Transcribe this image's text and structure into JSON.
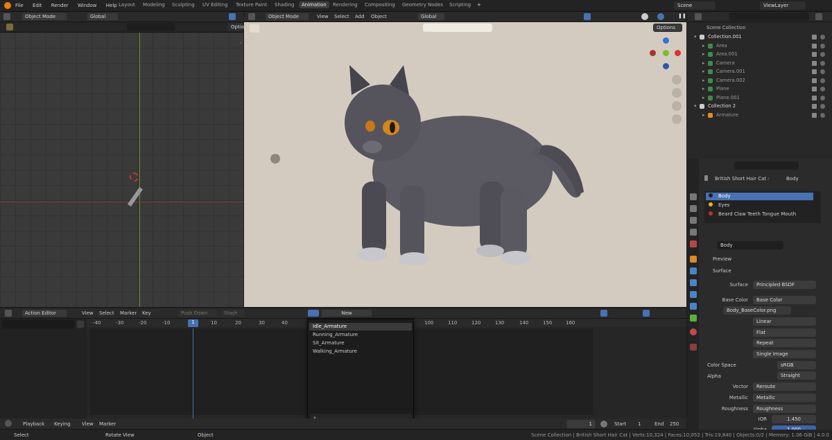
{
  "topbar": {
    "menu": [
      "File",
      "Edit",
      "Render",
      "Window",
      "Help"
    ],
    "workspaces": [
      "Layout",
      "Modeling",
      "Sculpting",
      "UV Editing",
      "Texture Paint",
      "Shading",
      "Animation",
      "Rendering",
      "Compositing",
      "Geometry Nodes",
      "Scripting"
    ],
    "active_ws": "Animation",
    "add": "+",
    "scene": "Scene",
    "view_layer": "ViewLayer"
  },
  "left_view": {
    "mode": "Object Mode",
    "orientation": "Global",
    "options": "Optio"
  },
  "main_view": {
    "mode": "Object Mode",
    "menus": [
      "View",
      "Select",
      "Add",
      "Object"
    ],
    "orientation": "Global",
    "options": "Options"
  },
  "outliner": {
    "title": "Scene Collection",
    "items": [
      {
        "label": "Collection.001",
        "indent": 0,
        "kind": "collection"
      },
      {
        "label": "Area",
        "indent": 1,
        "kind": "light"
      },
      {
        "label": "Area.001",
        "indent": 1,
        "kind": "light"
      },
      {
        "label": "Camera",
        "indent": 1,
        "kind": "camera"
      },
      {
        "label": "Camera.001",
        "indent": 1,
        "kind": "camera"
      },
      {
        "label": "Camera.002",
        "indent": 1,
        "kind": "camera"
      },
      {
        "label": "Plane",
        "indent": 1,
        "kind": "mesh"
      },
      {
        "label": "Plane.001",
        "indent": 1,
        "kind": "mesh"
      },
      {
        "label": "Collection 2",
        "indent": 0,
        "kind": "collection"
      },
      {
        "label": "Armature",
        "indent": 1,
        "kind": "armature"
      }
    ]
  },
  "properties": {
    "breadcrumb_obj": "British Short Hair Cat",
    "breadcrumb_mat": "Body",
    "slots": [
      "Body",
      "Eyes",
      "Beard Claw Teeth Tongue Mouth"
    ],
    "material": "Body",
    "preview": "Preview",
    "surface_section": "Surface",
    "rows": [
      {
        "label": "Surface",
        "value": "Principled BSDF"
      },
      {
        "label": "Base Color",
        "value": "Base Color"
      }
    ],
    "image": "Body_BaseColor.png",
    "img_opts": [
      "Linear",
      "Flat",
      "Repeat",
      "Single Image"
    ],
    "color_space_label": "Color Space",
    "color_space": "sRGB",
    "alpha_label": "Alpha",
    "alpha": "Straight",
    "inputs": [
      {
        "label": "Vector",
        "value": "Reroute"
      },
      {
        "label": "Metallic",
        "value": "Metallic"
      },
      {
        "label": "Roughness",
        "value": "Roughness"
      }
    ],
    "ior_label": "IOR",
    "ior": "1.450",
    "alpha2_label": "Alpha",
    "alpha2": "1.000"
  },
  "action_editor": {
    "mode": "Action Editor",
    "menus": [
      "View",
      "Select",
      "Marker",
      "Key"
    ],
    "push_down": "Push Down",
    "stash": "Stash",
    "new": "New",
    "ticks": [
      "-40",
      "-30",
      "-20",
      "-10",
      "1",
      "10",
      "20",
      "30",
      "40",
      "100",
      "110",
      "120",
      "130",
      "140",
      "150",
      "160"
    ],
    "current_frame": "1",
    "dropdown": [
      "Idle_Armature",
      "Running_Armature",
      "Sit_Armature",
      "Walking_Armature"
    ]
  },
  "timeline": {
    "playback": "Playback",
    "keying": "Keying",
    "view": "View",
    "marker": "Marker",
    "frame": "1",
    "start_label": "Start",
    "start": "1",
    "end_label": "End",
    "end": "250"
  },
  "status": {
    "select": "Select",
    "rotate": "Rotate View",
    "object": "Object",
    "info": "Scene Collection | British Short Hair Cat | Verts:10,324 | Faces:10,052 | Tris:19,840 | Objects:0/2 | Memory: 1.06 GiB | 4.0.0"
  },
  "colors": {
    "accent": "#4772b3",
    "selected": "#3e63a8"
  }
}
